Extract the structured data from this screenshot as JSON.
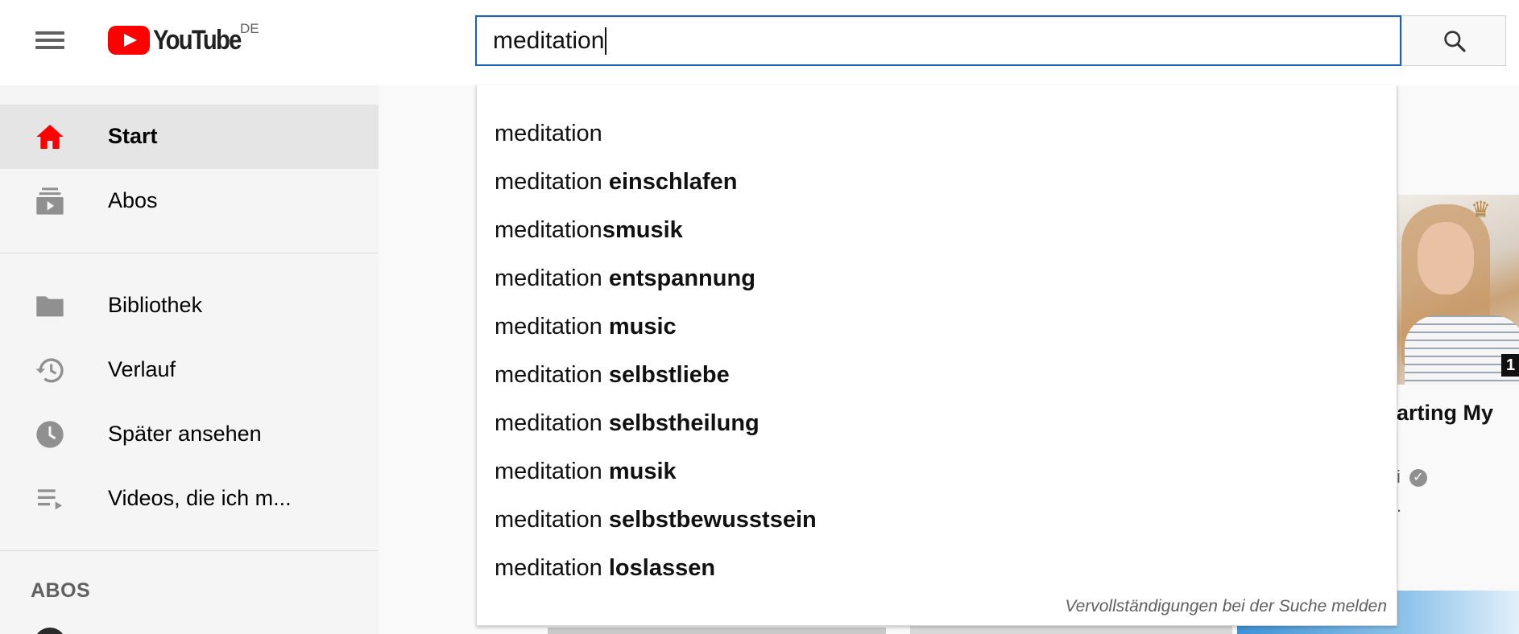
{
  "header": {
    "logo_text": "YouTube",
    "country": "DE",
    "search_value": "meditation"
  },
  "sidebar": {
    "items": [
      {
        "label": "Start",
        "icon": "home-icon"
      },
      {
        "label": "Abos",
        "icon": "subscriptions-icon"
      },
      {
        "label": "Bibliothek",
        "icon": "library-icon"
      },
      {
        "label": "Verlauf",
        "icon": "history-icon"
      },
      {
        "label": "Später ansehen",
        "icon": "watch-later-icon"
      },
      {
        "label": "Videos, die ich m...",
        "icon": "liked-videos-icon"
      }
    ],
    "section_title": "ABOS"
  },
  "suggestions": [
    {
      "prefix": "meditation",
      "bold": ""
    },
    {
      "prefix": "meditation ",
      "bold": "einschlafen"
    },
    {
      "prefix": "meditation",
      "bold": "smusik"
    },
    {
      "prefix": "meditation ",
      "bold": "entspannung"
    },
    {
      "prefix": "meditation ",
      "bold": "music"
    },
    {
      "prefix": "meditation ",
      "bold": "selbstliebe"
    },
    {
      "prefix": "meditation ",
      "bold": "selbstheilung"
    },
    {
      "prefix": "meditation ",
      "bold": "musik"
    },
    {
      "prefix": "meditation ",
      "bold": "selbstbewusstsein"
    },
    {
      "prefix": "meditation ",
      "bold": "loslassen"
    }
  ],
  "report_link": "Vervollständigungen bei der Suche melden",
  "background_video": {
    "title_fragment": "arting My",
    "duration_fragment": "1",
    "channel_fragment": "i",
    "meta_fragment": "."
  },
  "colors": {
    "brand_red": "#ff0000",
    "search_border": "#1c62b9",
    "active_item_bg": "#e5e5e5"
  }
}
